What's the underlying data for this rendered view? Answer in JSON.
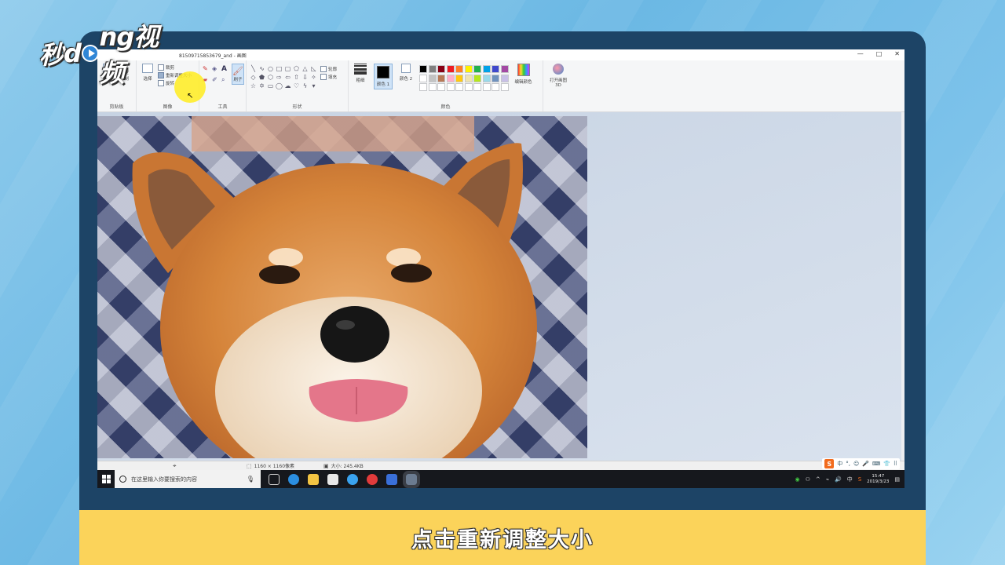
{
  "branding": {
    "logo_left": "秒",
    "logo_mid": "d",
    "logo_right": "ng视频"
  },
  "window": {
    "title": "81509715853679_and - 画图",
    "controls": [
      "—",
      "□",
      "✕"
    ]
  },
  "ribbon": {
    "clipboard": {
      "paste_label": "粘贴",
      "cut_label": "剪切",
      "copy_label": "复制",
      "group_label": "剪贴板"
    },
    "image": {
      "select_label": "选择",
      "crop_label": "裁剪",
      "resize_label": "重新调整大小",
      "rotate_label": "旋转",
      "group_label": "图像"
    },
    "tools": {
      "group_label": "工具",
      "brush_label": "刷子"
    },
    "shapes": {
      "outline_label": "轮廓",
      "fill_label": "填充",
      "group_label": "形状"
    },
    "size": {
      "label": "粗细"
    },
    "colors": {
      "color1_label": "颜色 1",
      "color2_label": "颜色 2",
      "edit_label": "编辑颜色",
      "group_label": "颜色",
      "palette": [
        "#000000",
        "#7f7f7f",
        "#880015",
        "#ed1c24",
        "#ff7f27",
        "#fff200",
        "#22b14c",
        "#00a2e8",
        "#3f48cc",
        "#a349a4",
        "#ffffff",
        "#c3c3c3",
        "#b97a57",
        "#ffaec9",
        "#ffc90e",
        "#efe4b0",
        "#b5e61d",
        "#99d9ea",
        "#7092be",
        "#c8bfe7",
        "#ffffff",
        "#ffffff",
        "#ffffff",
        "#ffffff",
        "#ffffff",
        "#ffffff",
        "#ffffff",
        "#ffffff",
        "#ffffff",
        "#ffffff"
      ]
    },
    "paint3d": {
      "label": "打开画图 3D"
    }
  },
  "status": {
    "dimensions": "1160 × 1160像素",
    "filesize": "大小: 245.4KB"
  },
  "taskbar": {
    "search_placeholder": "在这里输入你要搜索的内容",
    "time": "15:47",
    "date": "2019/3/23"
  },
  "ime": {
    "logo": "S",
    "lang": "中"
  },
  "subtitle": "点击重新调整大小"
}
